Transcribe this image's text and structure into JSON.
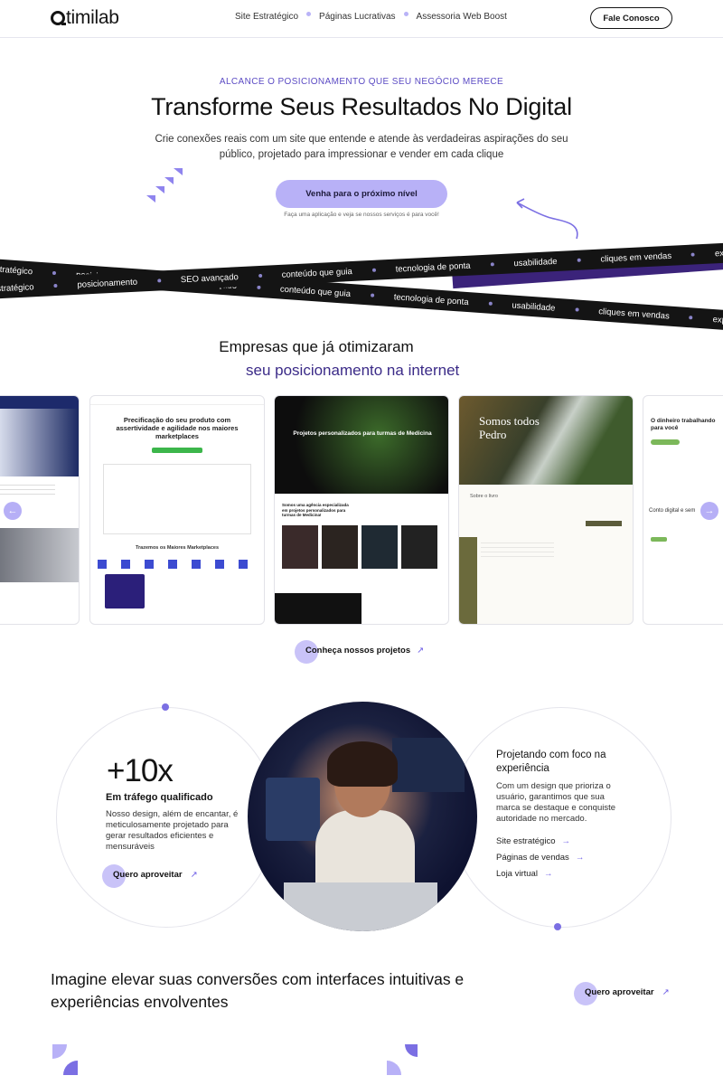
{
  "header": {
    "logo_text": "timilab",
    "nav": [
      "Site Estratégico",
      "Páginas Lucrativas",
      "Assessoria Web Boost"
    ],
    "cta": "Fale Conosco"
  },
  "hero": {
    "eyebrow": "ALCANCE O POSICIONAMENTO QUE SEU NEGÓCIO MERECE",
    "title": "Transforme Seus Resultados No Digital",
    "subtitle": "Crie conexões reais com um site que entende e atende às verdadeiras aspirações do seu público, projetado para impressionar e vender em cada clique",
    "button": "Venha para o próximo nível",
    "note": "Faça uma aplicação e veja se nossos serviços é para você!"
  },
  "ribbon_top": [
    "design estratégico",
    "posicionamento",
    "SEO avançado",
    "conteúdo que guia",
    "tecnologia de ponta",
    "usabilidade",
    "cliques em vendas",
    "experiência impactante"
  ],
  "ribbon_bottom": [
    "design estratégico",
    "posicionamento",
    "SEO avançado",
    "conteúdo que guia",
    "tecnologia de ponta",
    "usabilidade",
    "cliques em vendas",
    "experiência impactante"
  ],
  "projects": {
    "title_line1": "Empresas que já otimizaram",
    "title_line2": "seu posicionamento na internet",
    "button": "Conheça nossos projetos",
    "cards": [
      {
        "heading": ""
      },
      {
        "heading": "Precificação do seu produto com assertividade e agilidade nos maiores marketplaces",
        "sub": "Trazemos os Maiores Marketplaces"
      },
      {
        "heading": "Projetos personalizados para turmas de Medicina",
        "sub": "Somos uma agência especializada em projetos personalizados para turmas de Medicina!"
      },
      {
        "heading": "Somos todos Pedro",
        "sub": "Sobre o livro"
      },
      {
        "heading": "O dinheiro trabalhando para você",
        "sub": "Conto digital e sem"
      }
    ]
  },
  "feature": {
    "stat": "+10x",
    "stat_label": "Em tráfego qualificado",
    "stat_text": "Nosso design, além de encantar, é meticulosamente projetado para gerar resultados eficientes e mensuráveis",
    "stat_button": "Quero aproveitar",
    "right_title": "Projetando com foco na experiência",
    "right_text": "Com um design que prioriza o usuário, garantimos que sua marca se destaque e conquiste autoridade no mercado.",
    "links": [
      "Site estratégico",
      "Páginas de vendas",
      "Loja virtual"
    ]
  },
  "bottom": {
    "title": "Imagine elevar suas conversões com interfaces intuitivas e experiências envolventes",
    "button": "Quero aproveitar"
  },
  "colors": {
    "accent": "#b8b1f7",
    "brand_purple": "#3b237a",
    "dark": "#141414"
  }
}
